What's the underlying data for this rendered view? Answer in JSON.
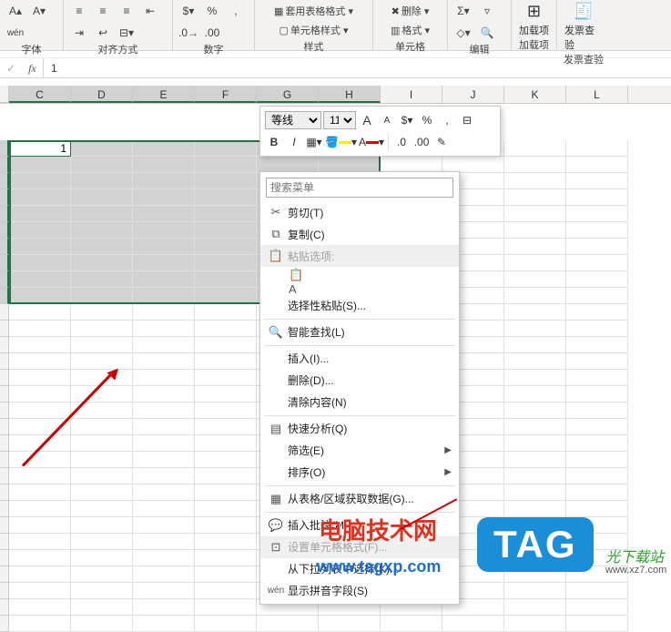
{
  "ribbon": {
    "font": {
      "wen": "wén",
      "label": "字体"
    },
    "align": {
      "label": "对齐方式"
    },
    "number": {
      "percent": "%",
      "comma": ",",
      "label": "数字"
    },
    "styles": {
      "table_fmt": "套用表格格式 ▾",
      "cell_style": "单元格样式 ▾",
      "label": "样式"
    },
    "cells": {
      "delete": "删除 ▾",
      "format": "格式 ▾",
      "label": "单元格"
    },
    "editing": {
      "label": "编辑"
    },
    "addins": {
      "btn": "加载项",
      "label": "加载项"
    },
    "invoice": {
      "btn": "发票查验",
      "label": "发票查验"
    }
  },
  "formula": {
    "cancel": "✓",
    "fx": "fx",
    "value": "1"
  },
  "cols": [
    "C",
    "D",
    "E",
    "F",
    "G",
    "H",
    "I",
    "J",
    "K",
    "L"
  ],
  "active_cell_value": "1",
  "mini": {
    "font": "等线",
    "size": "11",
    "A_inc": "A",
    "A_dec": "A",
    "percent": "%",
    "comma": ",",
    "B": "B",
    "I": "I"
  },
  "menu": {
    "search_placeholder": "搜索菜单",
    "cut": "剪切(T)",
    "copy": "复制(C)",
    "paste_opts": "粘贴选项:",
    "paste_special": "选择性粘贴(S)...",
    "smart_lookup": "智能查找(L)",
    "insert": "插入(I)...",
    "delete": "删除(D)...",
    "clear": "清除内容(N)",
    "quick_analysis": "快速分析(Q)",
    "filter": "筛选(E)",
    "sort": "排序(O)",
    "from_table": "从表格/区域获取数据(G)...",
    "insert_comment": "插入批注(M)...",
    "format_cells": "设置单元格格式(F)...",
    "pick_from_list": "从下拉列表中选择(K)...",
    "show_pinyin": "显示拼音字段(S)"
  },
  "watermark": {
    "title": "电脑技术网",
    "url": "www.tagxp.com",
    "tag": "TAG",
    "site": "光下载站",
    "site_url": "www.xz7.com"
  }
}
